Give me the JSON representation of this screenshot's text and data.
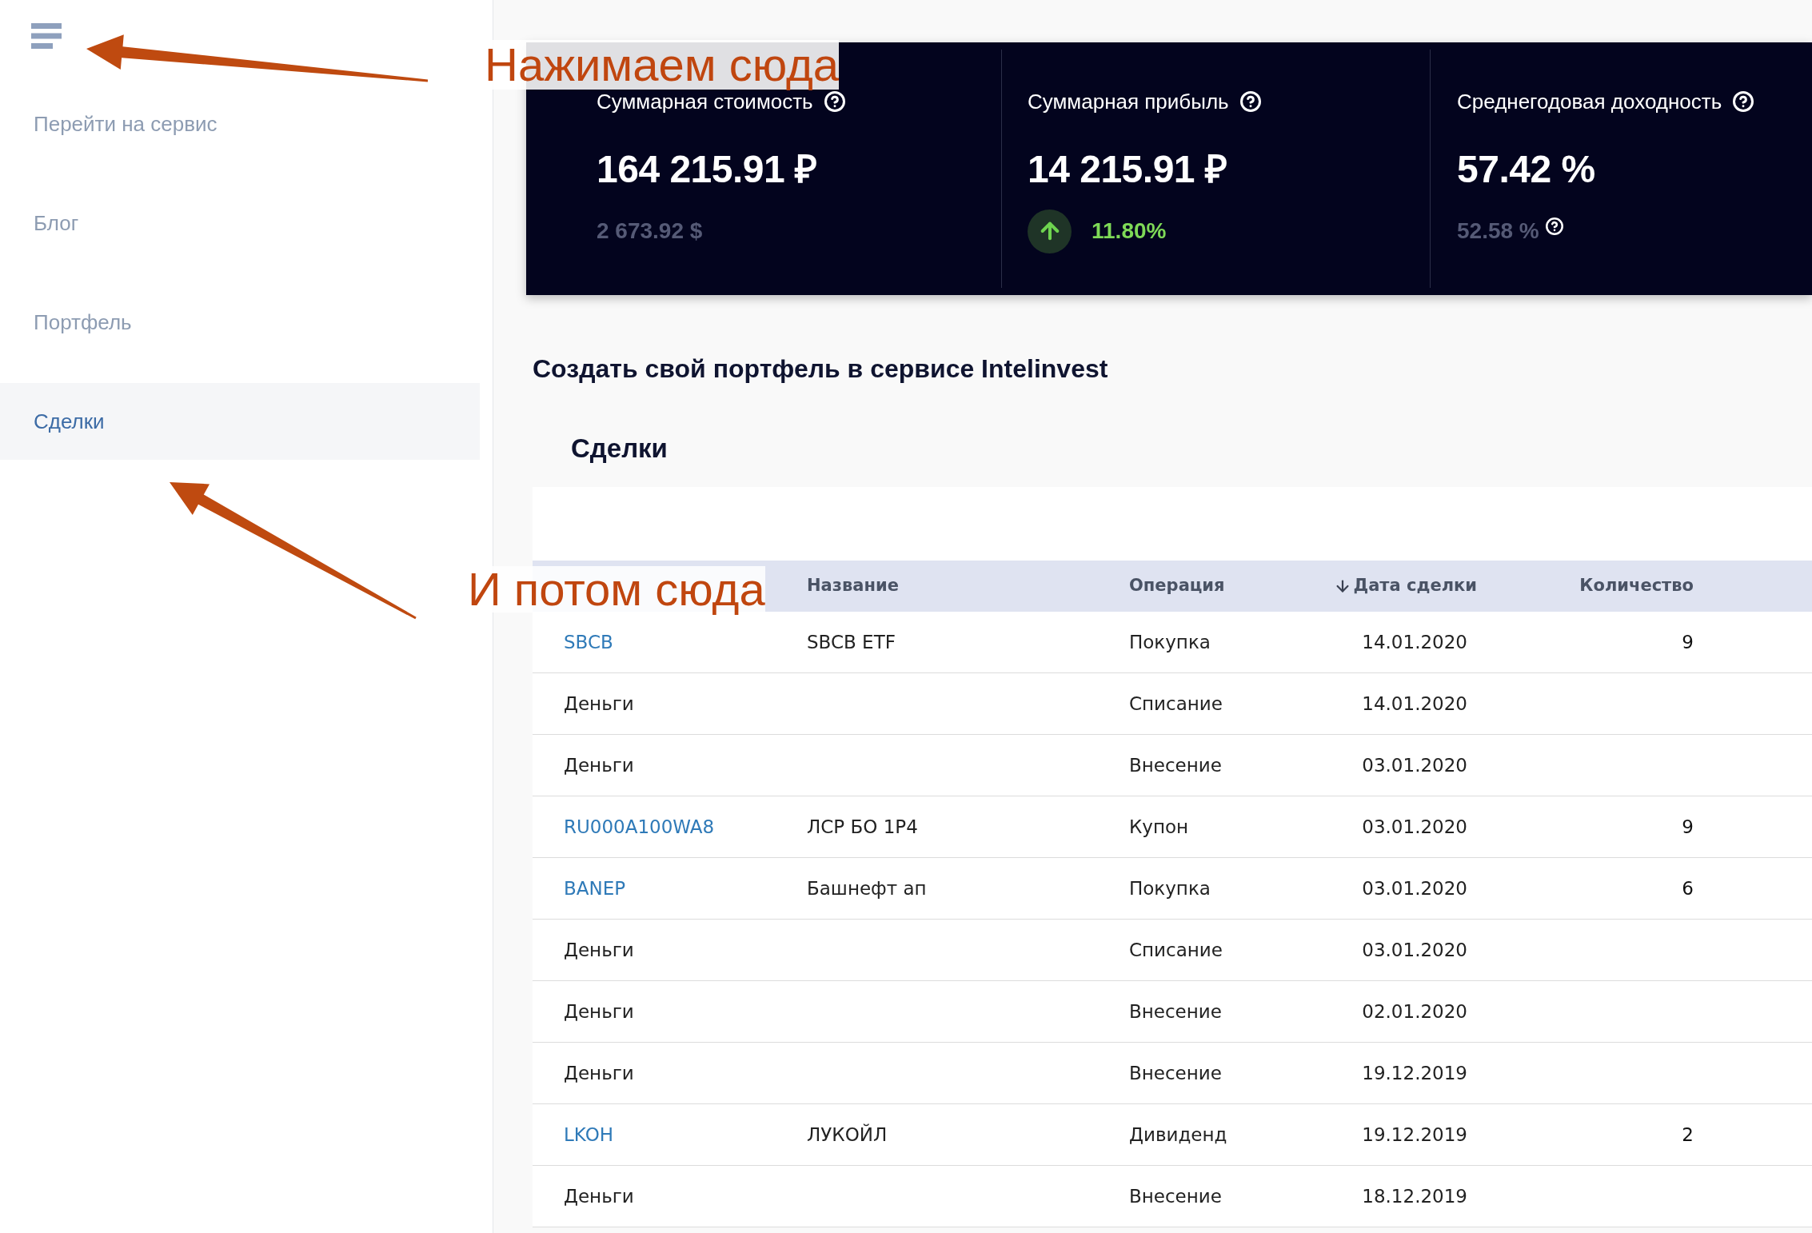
{
  "sidebar": {
    "items": [
      {
        "label": "Перейти на сервис",
        "selected": false
      },
      {
        "label": "Блог",
        "selected": false
      },
      {
        "label": "Портфель",
        "selected": false
      },
      {
        "label": "Сделки",
        "selected": true
      }
    ]
  },
  "summary": [
    {
      "kind": "converted",
      "label": "Суммарная стоимость",
      "value": "164 215.91 ₽",
      "secondary": "2 673.92 $"
    },
    {
      "kind": "change",
      "label": "Суммарная прибыль",
      "value": "14 215.91 ₽",
      "secondary": "11.80%"
    },
    {
      "kind": "average",
      "label": "Среднегодовая доходность",
      "value": "57.42 %",
      "secondary": "52.58 %"
    }
  ],
  "page_title": "Создать свой портфель в сервисе Intelinvest",
  "trades": {
    "title": "Сделки",
    "columns": [
      {
        "label": "Название",
        "sorted": false
      },
      {
        "label": "Операция",
        "sorted": false
      },
      {
        "label": "Дата сделки",
        "sorted": true
      },
      {
        "label": "Количество",
        "sorted": false
      }
    ],
    "rows": [
      {
        "kind": "security",
        "ticker": "SBCB",
        "name": "SBCB ETF",
        "operation": "Покупка",
        "date": "14.01.2020",
        "quantity": "9"
      },
      {
        "kind": "cash",
        "ticker": "Деньги",
        "operation": "Списание",
        "date": "14.01.2020"
      },
      {
        "kind": "cash",
        "ticker": "Деньги",
        "operation": "Внесение",
        "date": "03.01.2020"
      },
      {
        "kind": "security",
        "ticker": "RU000A100WA8",
        "name": "ЛСР БО 1Р4",
        "operation": "Купон",
        "date": "03.01.2020",
        "quantity": "9"
      },
      {
        "kind": "security",
        "ticker": "BANEP",
        "name": "Башнефт ап",
        "operation": "Покупка",
        "date": "03.01.2020",
        "quantity": "6"
      },
      {
        "kind": "cash",
        "ticker": "Деньги",
        "operation": "Списание",
        "date": "03.01.2020"
      },
      {
        "kind": "cash",
        "ticker": "Деньги",
        "operation": "Внесение",
        "date": "02.01.2020"
      },
      {
        "kind": "cash",
        "ticker": "Деньги",
        "operation": "Внесение",
        "date": "19.12.2019"
      },
      {
        "kind": "security",
        "ticker": "LKOH",
        "name": "ЛУКОЙЛ",
        "operation": "Дивиденд",
        "date": "19.12.2019",
        "quantity": "2"
      },
      {
        "kind": "cash",
        "ticker": "Деньги",
        "operation": "Внесение",
        "date": "18.12.2019"
      }
    ]
  },
  "annotations": [
    {
      "text": "Нажимаем сюда"
    },
    {
      "text": "И потом сюда"
    }
  ]
}
